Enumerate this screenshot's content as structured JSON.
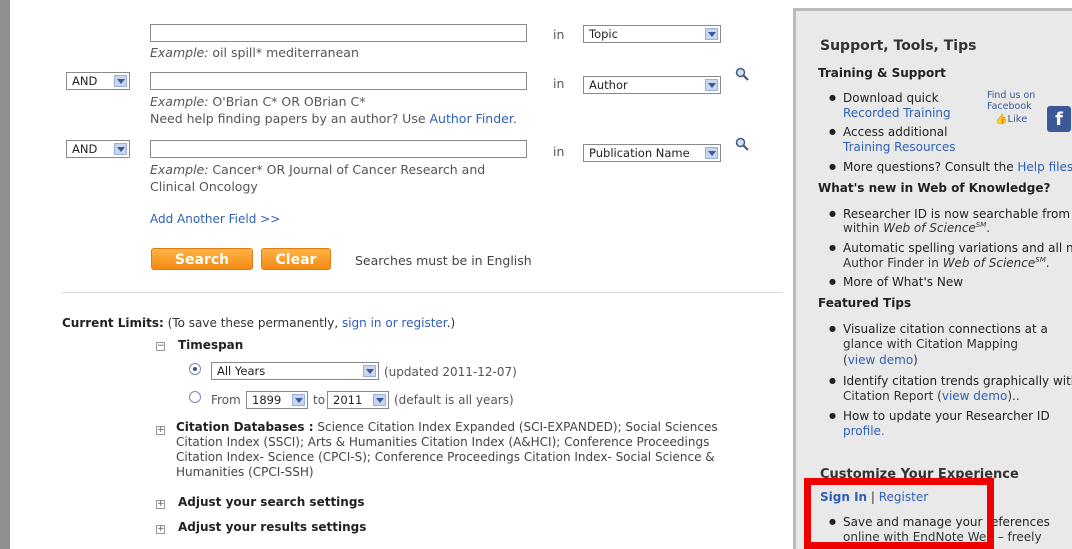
{
  "search": {
    "row1": {
      "value": "",
      "in": "in",
      "field": "Topic",
      "example_prefix": "Example:",
      "example": " oil spill* mediterranean"
    },
    "row2": {
      "bool": "AND",
      "value": "",
      "in": "in",
      "field": "Author",
      "example_prefix": "Example:",
      "example": " O'Brian C* OR OBrian C*",
      "help": "Need help finding papers by an author? Use ",
      "help_link": "Author Finder",
      "help_end": "."
    },
    "row3": {
      "bool": "AND",
      "value": "",
      "in": "in",
      "field": "Publication Name",
      "example_prefix": "Example:",
      "example_line1": " Cancer* OR Journal of Cancer Research and",
      "example_line2": "Clinical Oncology"
    },
    "add_field": "Add Another Field >>",
    "search_btn": "Search",
    "clear_btn": "Clear",
    "note": "Searches must be in English"
  },
  "limits": {
    "label": "Current Limits:",
    "text1": " (To save these permanently, ",
    "link": "sign in or register",
    "text2": ".)",
    "timespan": "Timespan",
    "years_option": "All Years",
    "updated": "(updated 2011-12-07)",
    "from": "From",
    "from_year": "1899",
    "to": "to",
    "to_year": "2011",
    "default_note": "(default is all years)",
    "cit_db_label": "Citation Databases :",
    "cit_db_l1": " Science Citation Index Expanded (SCI-EXPANDED); Social Sciences",
    "cit_db_l2": "Citation Index (SSCI); Arts & Humanities Citation Index (A&HCI); Conference Proceedings",
    "cit_db_l3": "Citation Index- Science (CPCI-S); Conference Proceedings Citation Index- Social Science &",
    "cit_db_l4": "Humanities (CPCI-SSH)",
    "adjust_search": "Adjust your search settings",
    "adjust_results": "Adjust your results settings"
  },
  "panel": {
    "title": "Support, Tools, Tips",
    "training_head": "Training & Support",
    "t1a": "Download quick",
    "t1b": "Recorded Training",
    "t2a": "Access additional",
    "t2b": "Training Resources",
    "t3": "More questions? Consult the ",
    "t3link": "Help files",
    "fb1": "Find us on",
    "fb2": "Facebook",
    "fb3": "Like",
    "whatsnew_head": "What's new in Web of Knowledge?",
    "w1a": "Researcher ID is now searchable from",
    "w1b": "within ",
    "w1b_i": "Web of Science",
    "w1b_sup": "SM",
    "w2a": "Automatic spelling variations and all n",
    "w2b": "Author Finder in ",
    "w2b_i": "Web of Science",
    "w2b_sup": "SM",
    "w3": "More of What's New",
    "tips_head": "Featured Tips",
    "f1a": "Visualize citation connections at a",
    "f1b": "glance with Citation Mapping",
    "f1c": "view demo",
    "f2a": "Identify citation trends graphically with",
    "f2b": "Citation Report (",
    "f2link": "view demo",
    "f2c": ")..",
    "f3a": "How to update your Researcher ID",
    "f3b": "profile.",
    "customize_head": "Customize Your Experience",
    "signin": "Sign In",
    "sep": " | ",
    "register": "Register",
    "c1a": "Save and manage your references",
    "c1b": "online with EndNote Web – freely"
  },
  "colors": {
    "accent_orange": "#f48a12",
    "link_blue": "#2f5fb3",
    "highlight_red": "#ee0000"
  }
}
